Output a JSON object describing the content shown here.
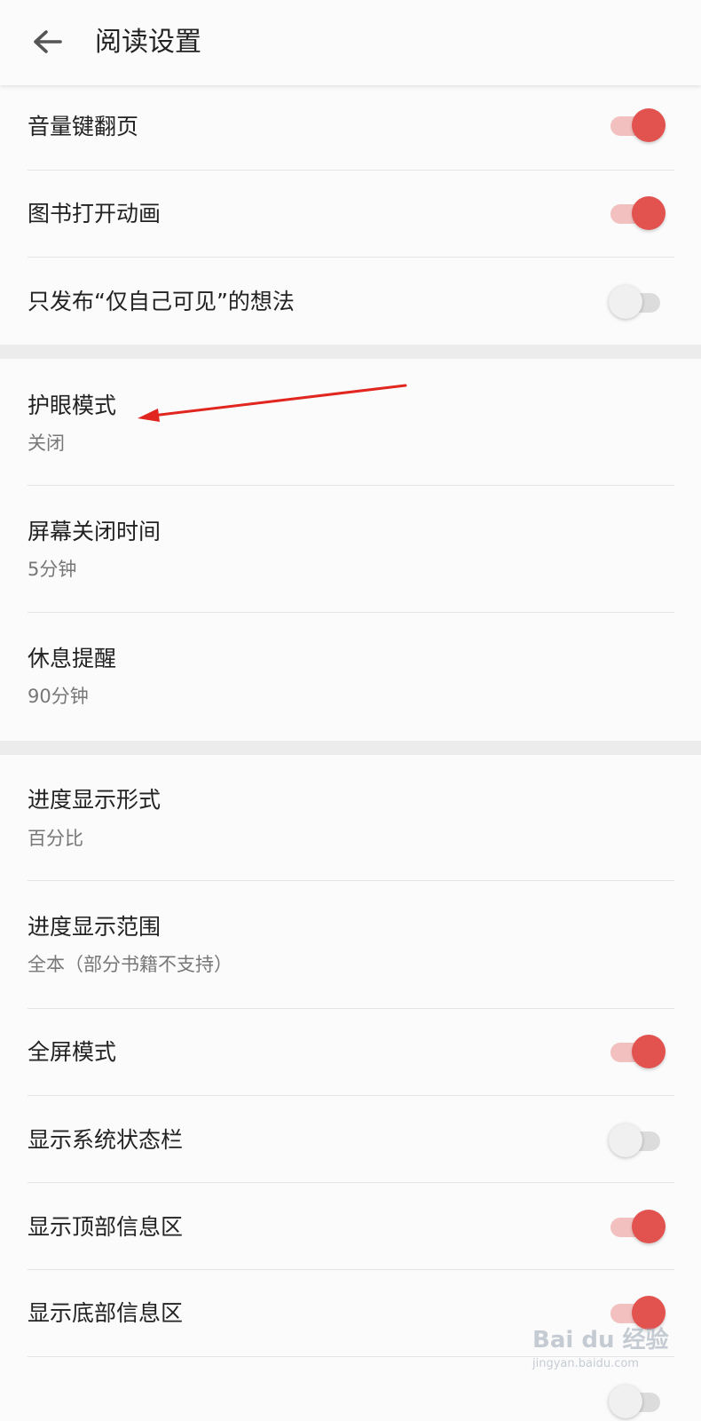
{
  "header": {
    "title": "阅读设置",
    "back_icon": "arrow-left-icon"
  },
  "section1": [
    {
      "label": "音量键翻页",
      "toggle": "on"
    },
    {
      "label": "图书打开动画",
      "toggle": "on"
    },
    {
      "label": "只发布“仅自己可见”的想法",
      "toggle": "off"
    }
  ],
  "section2": [
    {
      "label": "护眼模式",
      "value": "关闭"
    },
    {
      "label": "屏幕关闭时间",
      "value": "5分钟"
    },
    {
      "label": "休息提醒",
      "value": "90分钟"
    }
  ],
  "section3": [
    {
      "label": "进度显示形式",
      "value": "百分比"
    },
    {
      "label": "进度显示范围",
      "value": "全本（部分书籍不支持）"
    },
    {
      "label": "全屏模式",
      "toggle": "on"
    },
    {
      "label": "显示系统状态栏",
      "toggle": "off"
    },
    {
      "label": "显示顶部信息区",
      "toggle": "on"
    },
    {
      "label": "显示底部信息区",
      "toggle": "on"
    }
  ],
  "colors": {
    "accent": "#e2524f",
    "accent_track": "#f3c0c0",
    "annotation_arrow": "#e0261f"
  },
  "watermark": {
    "logo": "Bai du 经验",
    "url": "jingyan.baidu.com"
  }
}
